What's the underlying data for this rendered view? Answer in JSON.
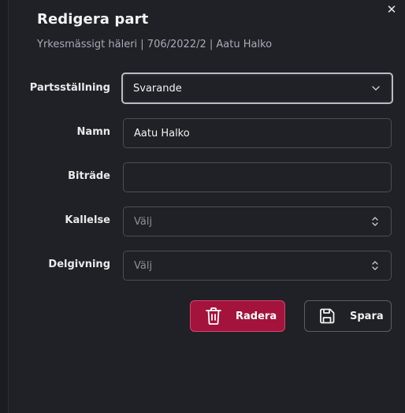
{
  "dialog": {
    "title": "Redigera part",
    "subtitle": "Yrkesmässigt häleri | 706/2022/2 | Aatu Halko",
    "close_icon": "close-icon"
  },
  "form": {
    "partsstallning": {
      "label": "Partsställning",
      "value": "Svarande"
    },
    "namn": {
      "label": "Namn",
      "value": "Aatu Halko"
    },
    "bitrade": {
      "label": "Biträde",
      "value": ""
    },
    "kallelse": {
      "label": "Kallelse",
      "placeholder": "Välj"
    },
    "delgivning": {
      "label": "Delgivning",
      "placeholder": "Välj"
    }
  },
  "actions": {
    "delete_label": "Radera",
    "save_label": "Spara"
  },
  "colors": {
    "delete_bg": "#a3133b",
    "modal_bg": "#1f2126"
  }
}
